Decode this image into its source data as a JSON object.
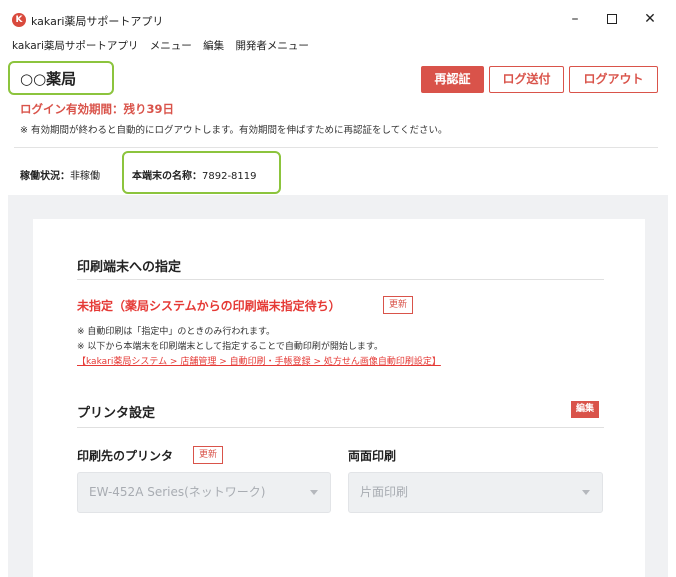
{
  "window": {
    "title": "kakari薬局サポートアプリ",
    "logo_letter": "K",
    "minimize_glyph": "–",
    "close_glyph": "✕"
  },
  "menu": {
    "items": [
      "kakari薬局サポートアプリ",
      "メニュー",
      "編集",
      "開発者メニュー"
    ]
  },
  "header": {
    "store_name": "○○薬局",
    "reauth_label": "再認証",
    "send_log_label": "ログ送付",
    "logout_label": "ログアウト",
    "login_validity": "ログイン有効期間：残り39日",
    "login_note": "※ 有効期間が終わると自動的にログアウトします。有効期間を伸ばすために再認証をしてください。"
  },
  "status": {
    "label": "稼働状況：",
    "value": "非稼働",
    "device_label": "本端末の名称：",
    "device_value": "7892-8119"
  },
  "print_terminal": {
    "title": "印刷端末への指定",
    "state": "未指定（薬局システムからの印刷端末指定待ち）",
    "refresh_label": "更新",
    "note1": "※ 自動印刷は「指定中」のときのみ行われます。",
    "note2": "※ 以下から本端末を印刷端末として指定することで自動印刷が開始します。",
    "link": "【kakari薬局システム > 店舗管理 > 自動印刷・手帳登録 > 処方せん画像自動印刷設定】"
  },
  "printer_settings": {
    "title": "プリンタ設定",
    "edit_label": "編集",
    "printer_label": "印刷先のプリンタ",
    "printer_refresh_label": "更新",
    "printer_value": "EW-452A Series(ネットワーク)",
    "duplex_label": "両面印刷",
    "duplex_value": "片面印刷"
  },
  "colors": {
    "accent": "#d9534a",
    "highlight": "#8cc43d",
    "background_gray": "#f0f1f3"
  }
}
